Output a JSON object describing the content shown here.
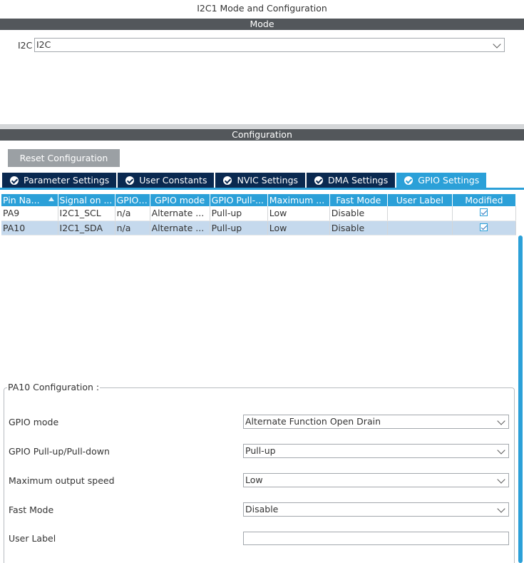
{
  "title": "I2C1 Mode and Configuration",
  "mode_section": {
    "header": "Mode",
    "i2c_label": "I2C",
    "i2c_value": "I2C"
  },
  "config_section": {
    "header": "Configuration",
    "reset_button": "Reset Configuration"
  },
  "tabs": [
    {
      "label": "Parameter Settings",
      "active": false
    },
    {
      "label": "User Constants",
      "active": false
    },
    {
      "label": "NVIC Settings",
      "active": false
    },
    {
      "label": "DMA Settings",
      "active": false
    },
    {
      "label": "GPIO Settings",
      "active": true
    }
  ],
  "table": {
    "columns": [
      "Pin Na...",
      "Signal on ...",
      "GPIO ...",
      "GPIO mode",
      "GPIO Pull-...",
      "Maximum ...",
      "Fast Mode",
      "User Label",
      "Modified"
    ],
    "rows": [
      {
        "pin": "PA9",
        "signal": "I2C1_SCL",
        "gpio": "n/a",
        "mode": "Alternate ...",
        "pull": "Pull-up",
        "speed": "Low",
        "fast": "Disable",
        "user_label": "",
        "modified": true,
        "selected": false
      },
      {
        "pin": "PA10",
        "signal": "I2C1_SDA",
        "gpio": "n/a",
        "mode": "Alternate ...",
        "pull": "Pull-up",
        "speed": "Low",
        "fast": "Disable",
        "user_label": "",
        "modified": true,
        "selected": true
      }
    ]
  },
  "pin_config": {
    "legend": "PA10 Configuration :",
    "gpio_mode_label": "GPIO mode",
    "gpio_mode_value": "Alternate Function Open Drain",
    "pull_label": "GPIO Pull-up/Pull-down",
    "pull_value": "Pull-up",
    "speed_label": "Maximum output speed",
    "speed_value": "Low",
    "fast_label": "Fast Mode",
    "fast_value": "Disable",
    "user_label_label": "User Label",
    "user_label_value": ""
  },
  "colors": {
    "tab_dark": "#0a2950",
    "accent": "#2ba0d8",
    "section_bar": "#53575b",
    "selected_row": "#c5d9ed"
  }
}
